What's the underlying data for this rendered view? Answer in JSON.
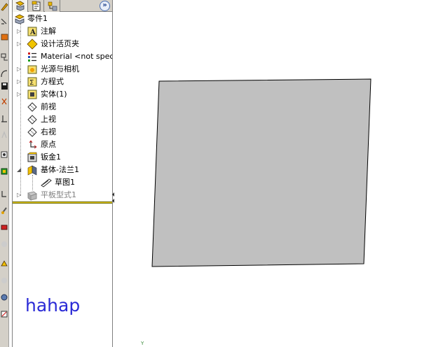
{
  "feature_tree": {
    "tabs": [
      {
        "name": "feature-manager-tab",
        "icon": "feature-manager-icon",
        "active": true
      },
      {
        "name": "property-manager-tab",
        "icon": "property-manager-icon",
        "active": false
      },
      {
        "name": "configuration-manager-tab",
        "icon": "configuration-manager-icon",
        "active": false
      }
    ],
    "expand_glyph": "»",
    "items": [
      {
        "label": "零件1",
        "icon": "part-icon"
      },
      {
        "label": "注解",
        "icon": "annotations-icon"
      },
      {
        "label": "设计活页夹",
        "icon": "design-binder-icon"
      },
      {
        "label": "Material <not specified>",
        "icon": "material-icon"
      },
      {
        "label": "光源与相机",
        "icon": "lights-cameras-icon"
      },
      {
        "label": "方程式",
        "icon": "equations-icon"
      },
      {
        "label": "实体(1)",
        "icon": "solid-bodies-icon"
      },
      {
        "label": "前视",
        "icon": "plane-icon"
      },
      {
        "label": "上视",
        "icon": "plane-icon"
      },
      {
        "label": "右视",
        "icon": "plane-icon"
      },
      {
        "label": "原点",
        "icon": "origin-icon"
      },
      {
        "label": "钣金1",
        "icon": "sheet-metal-icon"
      },
      {
        "label": "基体-法兰1",
        "icon": "base-flange-icon"
      },
      {
        "label": "草图1",
        "icon": "sketch-icon"
      },
      {
        "label": "平板型式1",
        "icon": "flat-pattern-icon"
      }
    ]
  },
  "watermark": {
    "text": "hahap"
  },
  "viewport": {
    "triad_axis_label": "Y",
    "part_fill": "#c0c0c0",
    "part_stroke": "#000000"
  }
}
